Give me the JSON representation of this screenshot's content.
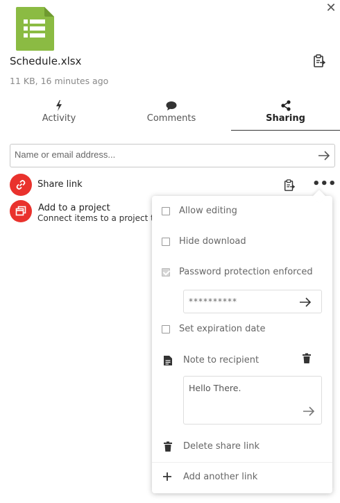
{
  "colors": {
    "accent": "#e9322d",
    "file_icon": "#8bbb43",
    "muted_text": "#666666"
  },
  "header": {
    "close_icon": "close-icon",
    "filename": "Schedule.xlsx",
    "meta": "11 KB, 16 minutes ago",
    "file_icon": "spreadsheet-icon"
  },
  "tabs": [
    {
      "label": "Activity",
      "icon": "bolt-icon",
      "active": false
    },
    {
      "label": "Comments",
      "icon": "comment-icon",
      "active": false
    },
    {
      "label": "Sharing",
      "icon": "share-icon",
      "active": true
    }
  ],
  "share_input": {
    "placeholder": "Name or email address..."
  },
  "rows": {
    "share_link_label": "Share link",
    "project_label": "Add to a project",
    "project_sub": "Connect items to a project to make them easier to find"
  },
  "menu": {
    "allow_editing": {
      "label": "Allow editing",
      "checked": false
    },
    "hide_download": {
      "label": "Hide download",
      "checked": false
    },
    "password_protection": {
      "label": "Password protection enforced",
      "checked": true,
      "disabled": true
    },
    "password_value": "**********",
    "expiration": {
      "label": "Set expiration date",
      "checked": false
    },
    "note_label": "Note to recipient",
    "note_text": "Hello There.",
    "delete_label": "Delete share link",
    "add_label": "Add another link"
  }
}
